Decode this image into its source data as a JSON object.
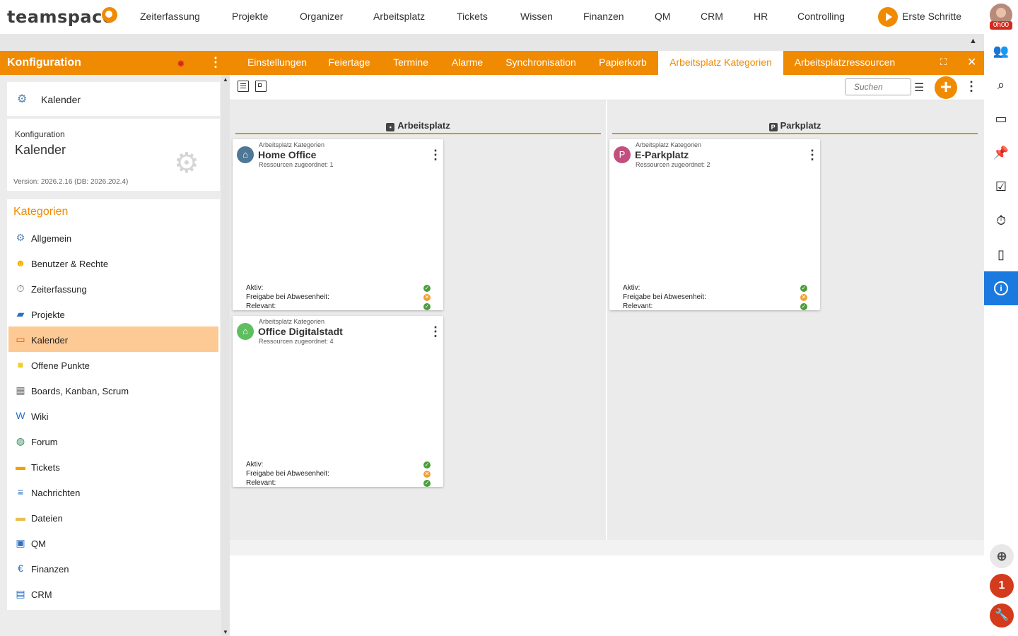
{
  "app": {
    "logo": "teamspace"
  },
  "nav": {
    "items": [
      "Zeiterfassung",
      "Projekte",
      "Organizer",
      "Arbeitsplatz",
      "Tickets",
      "Wissen",
      "Finanzen",
      "QM",
      "CRM",
      "HR",
      "Controlling"
    ],
    "first_steps": "Erste Schritte",
    "timer": "0h00"
  },
  "sidebar": {
    "title": "Konfiguration",
    "current": "Kalender",
    "info": {
      "label": "Konfiguration",
      "title": "Kalender",
      "version": "Version: 2026.2.16 (DB: 2026.202.4)"
    },
    "categories_title": "Kategorien",
    "categories": [
      {
        "label": "Allgemein",
        "icon": "gears-icon"
      },
      {
        "label": "Benutzer & Rechte",
        "icon": "users-icon"
      },
      {
        "label": "Zeiterfassung",
        "icon": "stopwatch-icon"
      },
      {
        "label": "Projekte",
        "icon": "folder-icon"
      },
      {
        "label": "Kalender",
        "icon": "calendar-icon",
        "active": true
      },
      {
        "label": "Offene Punkte",
        "icon": "sticky-note-icon"
      },
      {
        "label": "Boards, Kanban, Scrum",
        "icon": "board-icon"
      },
      {
        "label": "Wiki",
        "icon": "wiki-icon"
      },
      {
        "label": "Forum",
        "icon": "forum-icon"
      },
      {
        "label": "Tickets",
        "icon": "ticket-icon"
      },
      {
        "label": "Nachrichten",
        "icon": "messages-icon"
      },
      {
        "label": "Dateien",
        "icon": "files-icon"
      },
      {
        "label": "QM",
        "icon": "qm-icon"
      },
      {
        "label": "Finanzen",
        "icon": "euro-icon"
      },
      {
        "label": "CRM",
        "icon": "crm-icon"
      }
    ]
  },
  "tabs": [
    {
      "label": "Einstellungen"
    },
    {
      "label": "Feiertage"
    },
    {
      "label": "Termine"
    },
    {
      "label": "Alarme"
    },
    {
      "label": "Synchronisation"
    },
    {
      "label": "Papierkorb"
    },
    {
      "label": "Arbeitsplatz Kategorien",
      "active": true
    },
    {
      "label": "Arbeitsplatzressourcen"
    }
  ],
  "toolbar": {
    "search_placeholder": "Suchen"
  },
  "columns": [
    {
      "title": "Arbeitsplatz",
      "cards": [
        {
          "subtitle": "Arbeitsplatz Kategorien",
          "title": "Home Office",
          "count": "Ressourcen zugeordnet: 1",
          "icon_color": "#4e7896",
          "attrs": [
            {
              "label": "Aktiv:",
              "status": "ok"
            },
            {
              "label": "Freigabe bei Abwesenheit:",
              "status": "warn"
            },
            {
              "label": "Relevant:",
              "status": "ok"
            }
          ]
        },
        {
          "subtitle": "Arbeitsplatz Kategorien",
          "title": "Office Digitalstadt",
          "count": "Ressourcen zugeordnet: 4",
          "icon_color": "#5fbf5f",
          "attrs": [
            {
              "label": "Aktiv:",
              "status": "ok"
            },
            {
              "label": "Freigabe bei Abwesenheit:",
              "status": "warn"
            },
            {
              "label": "Relevant:",
              "status": "ok"
            }
          ]
        }
      ]
    },
    {
      "title": "Parkplatz",
      "cards": [
        {
          "subtitle": "Arbeitsplatz Kategorien",
          "title": "E-Parkplatz",
          "count": "Ressourcen zugeordnet: 2",
          "icon_color": "#c2507e",
          "attrs": [
            {
              "label": "Aktiv:",
              "status": "ok"
            },
            {
              "label": "Freigabe bei Abwesenheit:",
              "status": "warn"
            },
            {
              "label": "Relevant:",
              "status": "ok"
            }
          ]
        }
      ]
    }
  ],
  "rail": {
    "badge_count": "1"
  }
}
